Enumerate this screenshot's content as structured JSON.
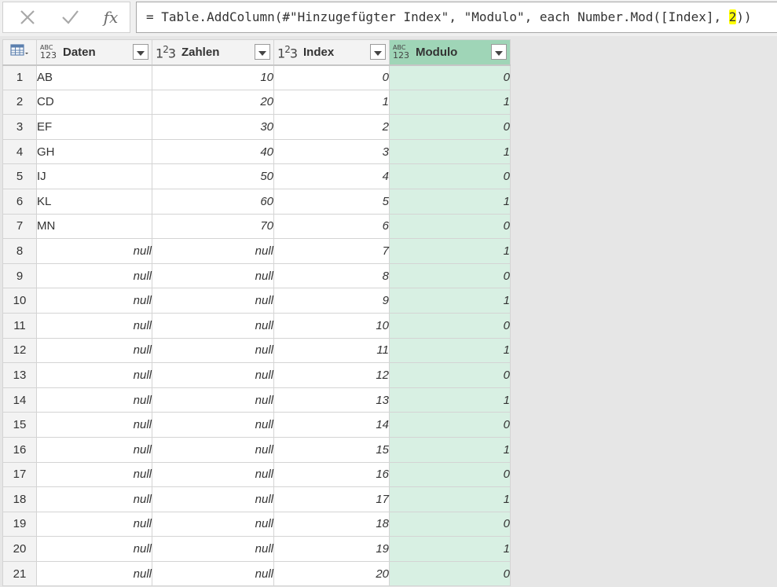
{
  "formula": {
    "prefix": "= Table.AddColumn(#\"Hinzugefügter Index\", \"Modulo\", each Number.Mod([Index], ",
    "highlight": "2",
    "suffix": "))"
  },
  "fx_label": "fx",
  "columns": [
    {
      "name": "Daten",
      "type_icon": "abc-123-icon"
    },
    {
      "name": "Zahlen",
      "type_icon": "number-123-icon"
    },
    {
      "name": "Index",
      "type_icon": "number-123-icon"
    },
    {
      "name": "Modulo",
      "type_icon": "abc-123-icon",
      "selected": true
    }
  ],
  "rows": [
    {
      "n": "1",
      "daten": "AB",
      "zahlen": "10",
      "index": "0",
      "modulo": "0"
    },
    {
      "n": "2",
      "daten": "CD",
      "zahlen": "20",
      "index": "1",
      "modulo": "1"
    },
    {
      "n": "3",
      "daten": "EF",
      "zahlen": "30",
      "index": "2",
      "modulo": "0"
    },
    {
      "n": "4",
      "daten": "GH",
      "zahlen": "40",
      "index": "3",
      "modulo": "1"
    },
    {
      "n": "5",
      "daten": "IJ",
      "zahlen": "50",
      "index": "4",
      "modulo": "0"
    },
    {
      "n": "6",
      "daten": "KL",
      "zahlen": "60",
      "index": "5",
      "modulo": "1"
    },
    {
      "n": "7",
      "daten": "MN",
      "zahlen": "70",
      "index": "6",
      "modulo": "0"
    },
    {
      "n": "8",
      "daten": "null",
      "zahlen": "null",
      "index": "7",
      "modulo": "1"
    },
    {
      "n": "9",
      "daten": "null",
      "zahlen": "null",
      "index": "8",
      "modulo": "0"
    },
    {
      "n": "10",
      "daten": "null",
      "zahlen": "null",
      "index": "9",
      "modulo": "1"
    },
    {
      "n": "11",
      "daten": "null",
      "zahlen": "null",
      "index": "10",
      "modulo": "0"
    },
    {
      "n": "12",
      "daten": "null",
      "zahlen": "null",
      "index": "11",
      "modulo": "1"
    },
    {
      "n": "13",
      "daten": "null",
      "zahlen": "null",
      "index": "12",
      "modulo": "0"
    },
    {
      "n": "14",
      "daten": "null",
      "zahlen": "null",
      "index": "13",
      "modulo": "1"
    },
    {
      "n": "15",
      "daten": "null",
      "zahlen": "null",
      "index": "14",
      "modulo": "0"
    },
    {
      "n": "16",
      "daten": "null",
      "zahlen": "null",
      "index": "15",
      "modulo": "1"
    },
    {
      "n": "17",
      "daten": "null",
      "zahlen": "null",
      "index": "16",
      "modulo": "0"
    },
    {
      "n": "18",
      "daten": "null",
      "zahlen": "null",
      "index": "17",
      "modulo": "1"
    },
    {
      "n": "19",
      "daten": "null",
      "zahlen": "null",
      "index": "18",
      "modulo": "0"
    },
    {
      "n": "20",
      "daten": "null",
      "zahlen": "null",
      "index": "19",
      "modulo": "1"
    },
    {
      "n": "21",
      "daten": "null",
      "zahlen": "null",
      "index": "20",
      "modulo": "0"
    }
  ],
  "colors": {
    "selected_header": "#9fd5b7",
    "selected_column": "#d8f0e3",
    "highlight": "#ffff00"
  }
}
